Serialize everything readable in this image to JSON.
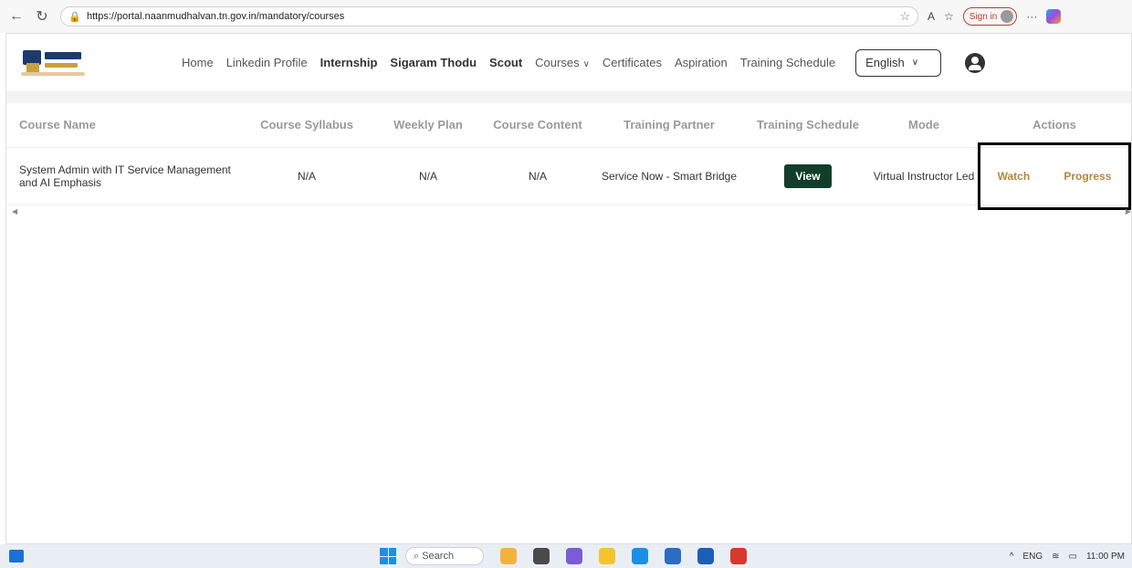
{
  "browser": {
    "url": "https://portal.naanmudhalvan.tn.gov.in/mandatory/courses",
    "signin_label": "Sign in"
  },
  "header": {
    "nav": [
      {
        "label": "Home",
        "bold": false
      },
      {
        "label": "Linkedin Profile",
        "bold": false
      },
      {
        "label": "Internship",
        "bold": true
      },
      {
        "label": "Sigaram Thodu",
        "bold": true
      },
      {
        "label": "Scout",
        "bold": true
      },
      {
        "label": "Courses",
        "bold": false
      },
      {
        "label": "Certificates",
        "bold": false
      },
      {
        "label": "Aspiration",
        "bold": false
      },
      {
        "label": "Training Schedule",
        "bold": false
      }
    ],
    "language": "English"
  },
  "table": {
    "columns": [
      "Course Name",
      "Course Syllabus",
      "Weekly Plan",
      "Course Content",
      "Training Partner",
      "Training Schedule",
      "Mode",
      "Actions"
    ],
    "row": {
      "course_name": "System Admin with IT Service Management and AI Emphasis",
      "syllabus": "N/A",
      "weekly_plan": "N/A",
      "content": "N/A",
      "partner": "Service Now - Smart Bridge",
      "schedule_button": "View",
      "mode": "Virtual Instructor Led",
      "watch": "Watch",
      "progress": "Progress"
    }
  },
  "taskbar": {
    "search": "Search",
    "lang": "ENG",
    "time": "11:00 PM"
  },
  "colors": {
    "accent": "#b1873a",
    "button": "#123d2d"
  }
}
